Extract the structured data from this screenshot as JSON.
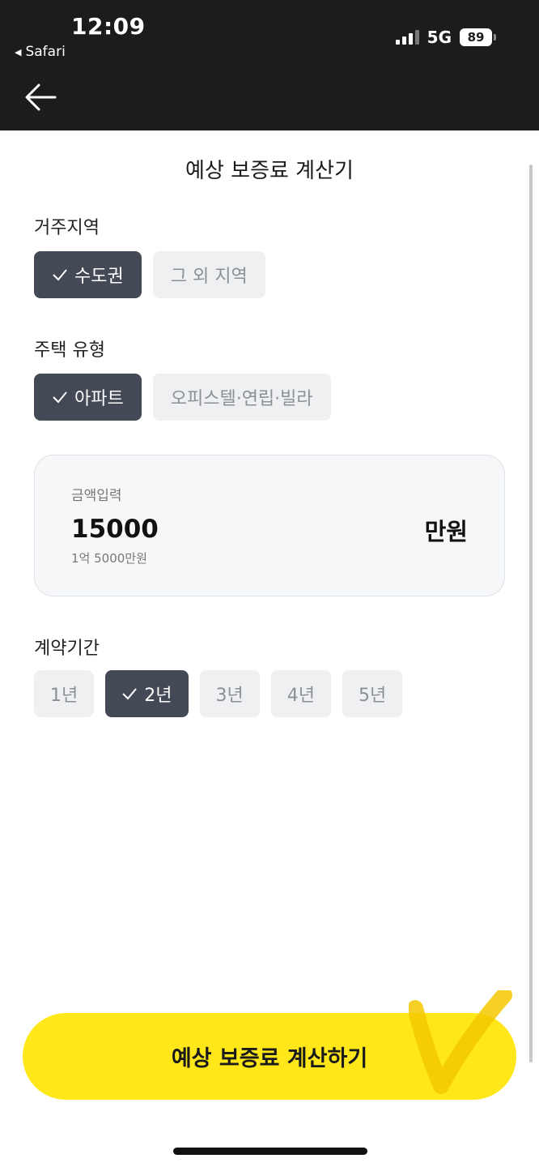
{
  "status_bar": {
    "time": "12:09",
    "back_app": "Safari",
    "network": "5G",
    "battery": "89"
  },
  "header": {
    "title": "예상 보증료 계산기"
  },
  "region": {
    "label": "거주지역",
    "options": [
      "수도권",
      "그 외 지역"
    ],
    "selected": "수도권"
  },
  "housing": {
    "label": "주택 유형",
    "options": [
      "아파트",
      "오피스텔·연립·빌라"
    ],
    "selected": "아파트"
  },
  "amount": {
    "label": "금액입력",
    "value": "15000",
    "unit": "만원",
    "hint": "1억 5000만원"
  },
  "period": {
    "label": "계약기간",
    "options": [
      "1년",
      "2년",
      "3년",
      "4년",
      "5년"
    ],
    "selected": "2년"
  },
  "cta": {
    "label": "예상 보증료 계산하기"
  },
  "colors": {
    "cta_background": "#ffe71a",
    "selected_chip": "#434a55",
    "unselected_chip": "#eff0f2"
  }
}
